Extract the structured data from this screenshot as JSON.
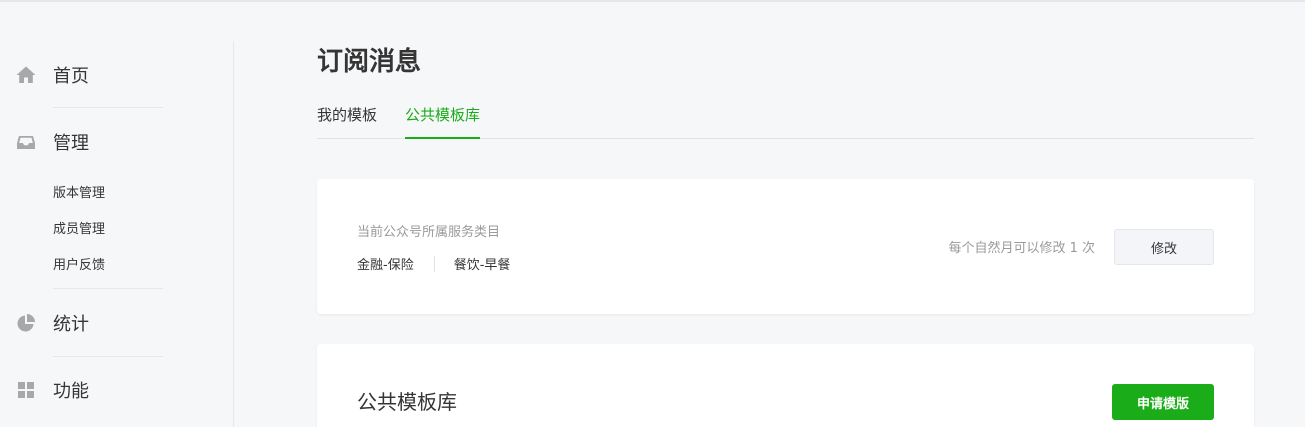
{
  "sidebar": {
    "home_label": "首页",
    "manage_label": "管理",
    "manage_items": [
      {
        "label": "版本管理"
      },
      {
        "label": "成员管理"
      },
      {
        "label": "用户反馈"
      }
    ],
    "stats_label": "统计",
    "features_label": "功能"
  },
  "page": {
    "title": "订阅消息",
    "tabs": [
      {
        "label": "我的模板"
      },
      {
        "label": "公共模板库"
      }
    ],
    "active_tab": "公共模板库"
  },
  "category_card": {
    "label": "当前公众号所属服务类目",
    "categories": [
      "金融-保险",
      "餐饮-早餐"
    ],
    "limit_text": "每个自然月可以修改 1 次",
    "modify_button": "修改"
  },
  "library_card": {
    "title": "公共模板库",
    "apply_button": "申请模版"
  },
  "colors": {
    "accent": "#1aad19",
    "icon": "#a8a8a8",
    "background": "#f6f7f9"
  }
}
